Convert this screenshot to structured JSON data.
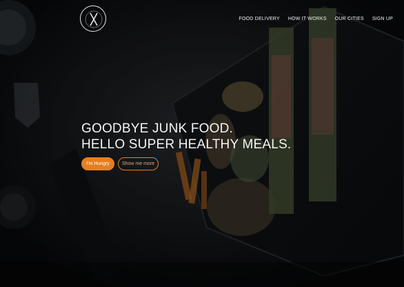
{
  "nav": {
    "items": [
      {
        "label": "FOOD DELIVERY"
      },
      {
        "label": "HOW IT WORKS"
      },
      {
        "label": "OUR CITIES"
      },
      {
        "label": "SIGN UP"
      }
    ]
  },
  "hero": {
    "headline_line1": "GOODBYE JUNK FOOD.",
    "headline_line2": "HELLO SUPER HEALTHY MEALS.",
    "primary_button": "I'm Hungry",
    "secondary_button": "Show me more"
  },
  "logo": {
    "icon": "fork-knife-icon"
  },
  "colors": {
    "accent": "#e67e22",
    "text": "#f5f5f5",
    "background": "#0d0f12"
  }
}
